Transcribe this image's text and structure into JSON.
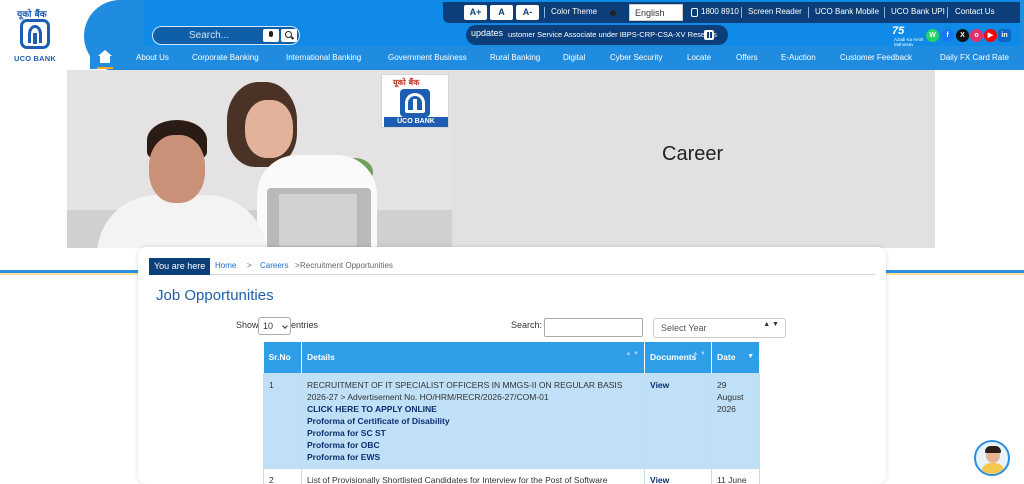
{
  "logo": {
    "hindi": "यूको बैंक",
    "text": "UCO BANK"
  },
  "search": {
    "placeholder": "Search..."
  },
  "utility": {
    "font_large": "A+",
    "font_normal": "A",
    "font_small": "A-",
    "color_theme": "Color Theme",
    "language": "English",
    "phone": "1800 8910",
    "links": [
      "Screen Reader",
      "UCO Bank Mobile",
      "UCO Bank UPI",
      "Contact Us"
    ]
  },
  "ticker": {
    "label": "updates",
    "text": "ustomer Service Associate under IBPS-CRP-CSA-XV Rese  Lis"
  },
  "azadi": {
    "num": "75",
    "sub": "Azadi Ka Amrit Mahotsav"
  },
  "social": [
    "W",
    "f",
    "X",
    "o",
    "▶",
    "in"
  ],
  "nav": {
    "items": [
      "About Us",
      "Corporate Banking",
      "International Banking",
      "Government Business",
      "Rural Banking",
      "Digital",
      "Cyber Security",
      "Locate",
      "Offers",
      "E-Auction",
      "Customer Feedback",
      "Daily FX Card Rate"
    ]
  },
  "banner": {
    "title": "Career",
    "card_hindi": "यूको बैंक",
    "card_text": "UCO BANK"
  },
  "breadcrumb": {
    "label": "You are here",
    "home": "Home",
    "sep": ">",
    "careers": "Careers",
    "current": "Recruitment Opportunities"
  },
  "page_title": "Job Opportunities",
  "controls": {
    "show_label": "Show",
    "show_value": "10",
    "entries_label": "entries",
    "search_label": "Search:",
    "year_placeholder": "Select Year",
    "year_arrows": "▲ ▼"
  },
  "table": {
    "headers": {
      "sr": "Sr.No",
      "details": "Details",
      "documents": "Documents",
      "date": "Date"
    },
    "sort_arrows": "▲ ▼",
    "sort_active": "▼",
    "rows": [
      {
        "sr": "1",
        "details": "RECRUITMENT OF IT SPECIALIST OFFICERS IN MMGS-II ON REGULAR BASIS 2026-27 > Advertisement No. HO/HRM/RECR/2026-27/COM-01",
        "links": [
          "CLICK HERE TO APPLY ONLINE",
          "Proforma of Certificate of Disability",
          "Proforma for SC ST",
          "Proforma for OBC",
          "Proforma for EWS"
        ],
        "documents": "View",
        "date": "29 August 2026"
      },
      {
        "sr": "2",
        "details": "List of Provisionally Shortlisted Candidates for Interview for the Post of Software",
        "documents": "View",
        "date": "11 June"
      }
    ]
  },
  "colors": {
    "header_blue": "#1f8ce0",
    "dark_navy": "#0c3f7a",
    "table_header": "#2e9ee9",
    "row_highlight": "#bfe0f6",
    "title_blue": "#1f5fa8"
  },
  "icons": {
    "home": "home-icon",
    "mic": "microphone-icon",
    "search": "search-icon",
    "phone": "phone-icon",
    "pause": "pause-icon",
    "chat": "chatbot-avatar-icon"
  }
}
